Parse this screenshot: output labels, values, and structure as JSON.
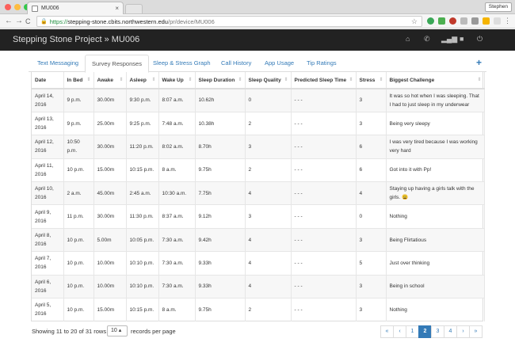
{
  "browser": {
    "tab_title": "MU006",
    "tab_close": "×",
    "user": "Stephen",
    "url_scheme": "https://",
    "url_host": "stepping-stone.cbits.northwestern.edu",
    "url_path": "/pr/device/MU006",
    "back": "←",
    "forward": "→",
    "reload": "C",
    "star": "☆",
    "menu": "⋮"
  },
  "app": {
    "brand": "Stepping Stone Project » MU006"
  },
  "tabs": [
    {
      "label": "Text Messaging"
    },
    {
      "label": "Survey Responses"
    },
    {
      "label": "Sleep & Stress Graph"
    },
    {
      "label": "Call History"
    },
    {
      "label": "App Usage"
    },
    {
      "label": "Tip Ratings"
    }
  ],
  "add_button": "+",
  "table": {
    "headers": [
      "Date",
      "In Bed",
      "Awake",
      "Asleep",
      "Wake Up",
      "Sleep Duration",
      "Sleep Quality",
      "Predicted Sleep Time",
      "Stress",
      "Biggest Challenge"
    ],
    "rows": [
      [
        "April 14, 2016",
        "9 p.m.",
        "30.00m",
        "9:30 p.m.",
        "8:07 a.m.",
        "10.62h",
        "0",
        "- - -",
        "3",
        "It was so hot when I was sleeping. That I had to just sleep in my underwear"
      ],
      [
        "April 13, 2016",
        "9 p.m.",
        "25.00m",
        "9:25 p.m.",
        "7:48 a.m.",
        "10.38h",
        "2",
        "- - -",
        "3",
        "Being very sleepy"
      ],
      [
        "April 12, 2016",
        "10:50 p.m.",
        "30.00m",
        "11:20 p.m.",
        "8:02 a.m.",
        "8.70h",
        "3",
        "- - -",
        "6",
        "I was very tired because I was working very hard"
      ],
      [
        "April 11, 2016",
        "10 p.m.",
        "15.00m",
        "10:15 p.m.",
        "8 a.m.",
        "9.75h",
        "2",
        "- - -",
        "6",
        "Got into it with Pp!"
      ],
      [
        "April 10, 2016",
        "2 a.m.",
        "45.00m",
        "2:45 a.m.",
        "10:30 a.m.",
        "7.75h",
        "4",
        "- - -",
        "4",
        "Staying up having a girls talk with the girls. 😩"
      ],
      [
        "April 9, 2016",
        "11 p.m.",
        "30.00m",
        "11:30 p.m.",
        "8:37 a.m.",
        "9.12h",
        "3",
        "- - -",
        "0",
        "Nothing"
      ],
      [
        "April 8, 2016",
        "10 p.m.",
        "5.00m",
        "10:05 p.m.",
        "7:30 a.m.",
        "9.42h",
        "4",
        "- - -",
        "3",
        "Being Flirtatious"
      ],
      [
        "April 7, 2016",
        "10 p.m.",
        "10.00m",
        "10:10 p.m.",
        "7:30 a.m.",
        "9.33h",
        "4",
        "- - -",
        "5",
        "Just over thinking"
      ],
      [
        "April 6, 2016",
        "10 p.m.",
        "10.00m",
        "10:10 p.m.",
        "7:30 a.m.",
        "9.33h",
        "4",
        "- - -",
        "3",
        "Being in school"
      ],
      [
        "April 5, 2016",
        "10 p.m.",
        "15.00m",
        "10:15 p.m.",
        "8 a.m.",
        "9.75h",
        "2",
        "- - -",
        "3",
        "Nothing"
      ]
    ]
  },
  "footer": {
    "showing": "Showing 11 to 20 of 31 rows",
    "per_page_value": "10 ▴",
    "per_page_label": "records per page",
    "pages": [
      "«",
      "‹",
      "1",
      "2",
      "3",
      "4",
      "›",
      "»"
    ],
    "current_page": "2"
  }
}
